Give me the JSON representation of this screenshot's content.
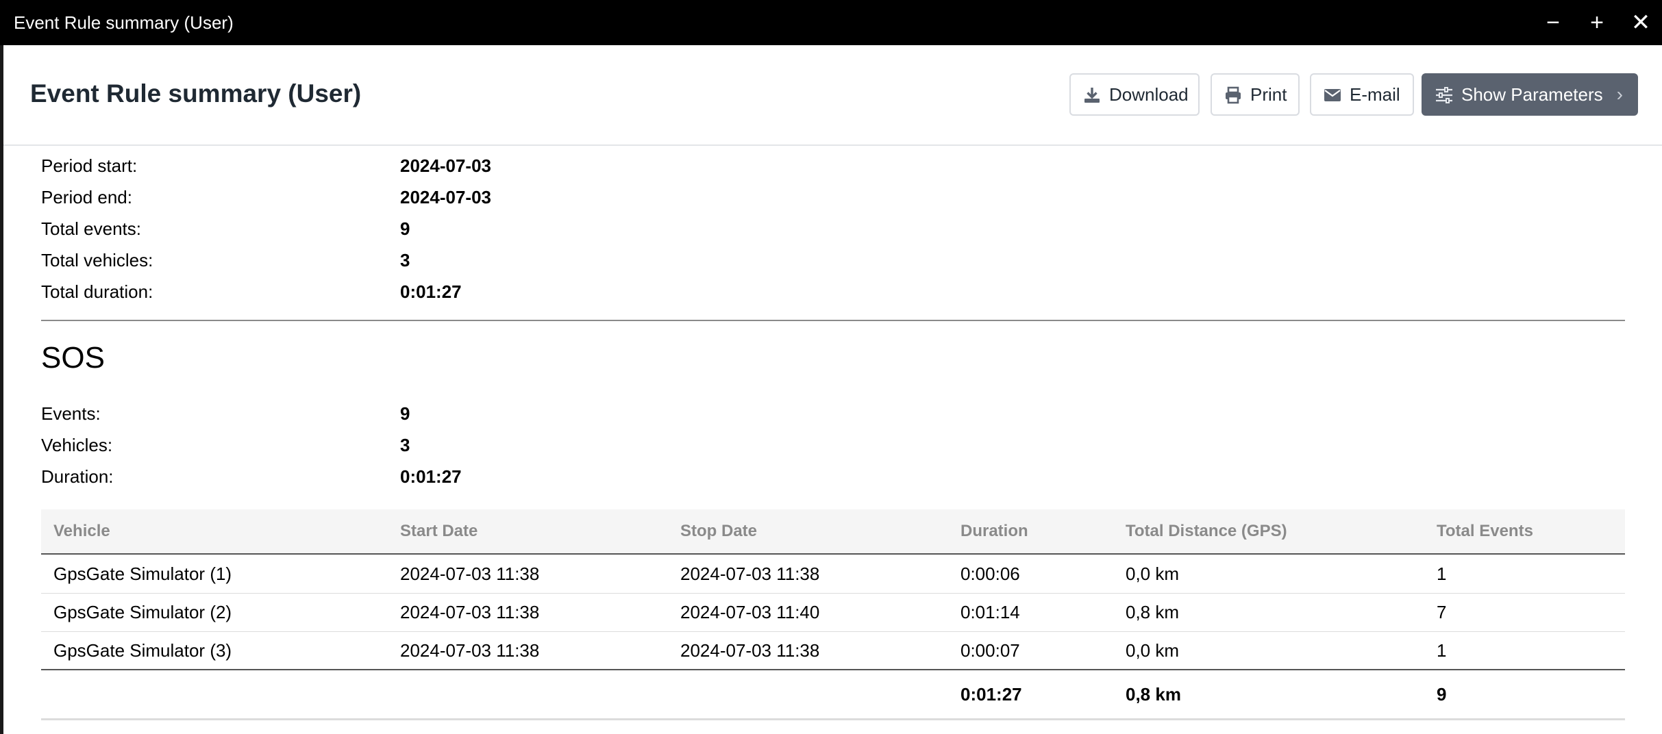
{
  "window": {
    "title": "Event Rule summary (User)",
    "minimize": "−",
    "maximize": "+",
    "close": "✕"
  },
  "header": {
    "title": "Event Rule summary (User)",
    "buttons": {
      "download": "Download",
      "print": "Print",
      "email": "E-mail",
      "show_parameters": "Show Parameters"
    }
  },
  "summary": [
    {
      "label": "Period start:",
      "value": "2024-07-03"
    },
    {
      "label": "Period end:",
      "value": "2024-07-03"
    },
    {
      "label": "Total events:",
      "value": "9"
    },
    {
      "label": "Total vehicles:",
      "value": "3"
    },
    {
      "label": "Total duration:",
      "value": "0:01:27"
    }
  ],
  "section": {
    "title": "SOS",
    "stats": [
      {
        "label": "Events:",
        "value": "9"
      },
      {
        "label": "Vehicles:",
        "value": "3"
      },
      {
        "label": "Duration:",
        "value": "0:01:27"
      }
    ],
    "table": {
      "headers": [
        "Vehicle",
        "Start Date",
        "Stop Date",
        "Duration",
        "Total Distance (GPS)",
        "Total Events"
      ],
      "rows": [
        [
          "GpsGate Simulator (1)",
          "2024-07-03 11:38",
          "2024-07-03 11:38",
          "0:00:06",
          "0,0 km",
          "1"
        ],
        [
          "GpsGate Simulator (2)",
          "2024-07-03 11:38",
          "2024-07-03 11:40",
          "0:01:14",
          "0,8 km",
          "7"
        ],
        [
          "GpsGate Simulator (3)",
          "2024-07-03 11:38",
          "2024-07-03 11:38",
          "0:00:07",
          "0,0 km",
          "1"
        ]
      ],
      "totals": {
        "duration": "0:01:27",
        "distance": "0,8 km",
        "events": "9"
      }
    }
  },
  "icons": {
    "download": "download-icon",
    "print": "printer-icon",
    "email": "envelope-icon",
    "parameters": "sliders-icon",
    "chevron": "chevron-right-icon"
  },
  "colors": {
    "titlebar": "#000000",
    "primary_button": "#5a626f"
  }
}
